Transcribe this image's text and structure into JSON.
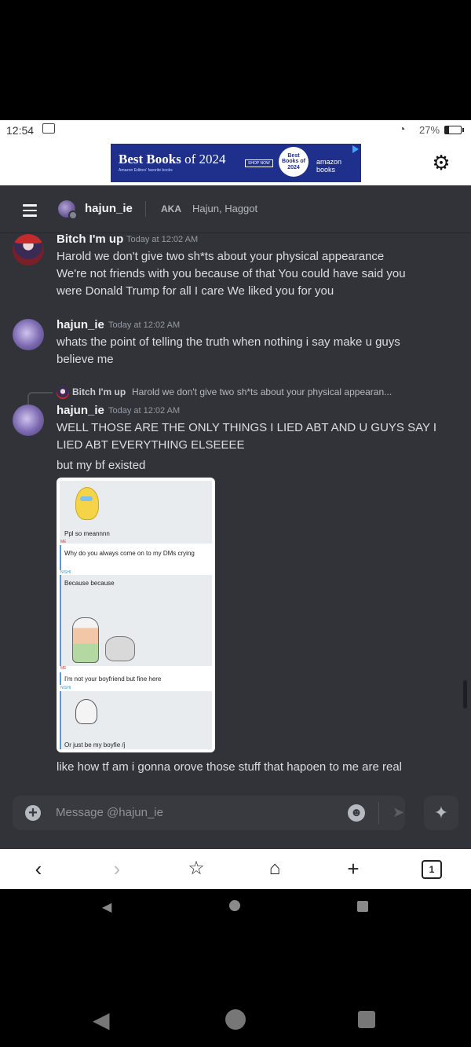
{
  "status_bar": {
    "time": "12:54",
    "battery": "27%",
    "battery_level": 0.27
  },
  "ad": {
    "headline_bold": "Best Books",
    "headline_rest": "of 2024",
    "tagline": "Amazon Editors' favorite books",
    "cta": "SHOP NOW",
    "badge": "Best Books of 2024",
    "brand": "amazon books"
  },
  "header": {
    "username": "hajun_ie",
    "aka_label": "AKA",
    "aliases": "Hajun, Haggot"
  },
  "messages": [
    {
      "author": "Bitch I'm up",
      "timestamp": "Today at 12:02 AM",
      "lines": [
        "Harold we don't give two sh*ts about your physical appearance",
        "We're not friends with you because of that You could have said you",
        "were Donald Trump for all I care We liked you for you"
      ]
    },
    {
      "author": "hajun_ie",
      "timestamp": "Today at 12:02 AM",
      "lines": [
        "whats the point of telling the truth when nothing i say make u guys",
        "believe me"
      ]
    },
    {
      "reply": {
        "author": "Bitch I'm up",
        "text": "Harold we don't give two sh*ts about your physical appearan..."
      },
      "author": "hajun_ie",
      "timestamp": "Today at 12:02 AM",
      "lines": [
        "WELL THOSE ARE THE ONLY THINGS I LIED ABT AND U GUYS SAY I",
        "LIED ABT EVERYTHING ELSEEEE"
      ],
      "followups": [
        "but my bf existed",
        "like how tf am i gonna orove those stuff that hapoen to me are real"
      ]
    }
  ],
  "attachment": {
    "chat": [
      {
        "text": "Ppl so meannnn"
      },
      {
        "label": "ME",
        "text": "Why do you always come on to my DMs crying"
      },
      {
        "label": "NISHI",
        "text": "Because because"
      },
      {
        "label": "ME",
        "text": "I'm not your boyfriend but fine here"
      },
      {
        "label": "NISHI",
        "text": "Or just be my boyfie /j"
      }
    ]
  },
  "composer": {
    "placeholder": "Message @hajun_ie"
  },
  "browser": {
    "tab_count": "1"
  }
}
